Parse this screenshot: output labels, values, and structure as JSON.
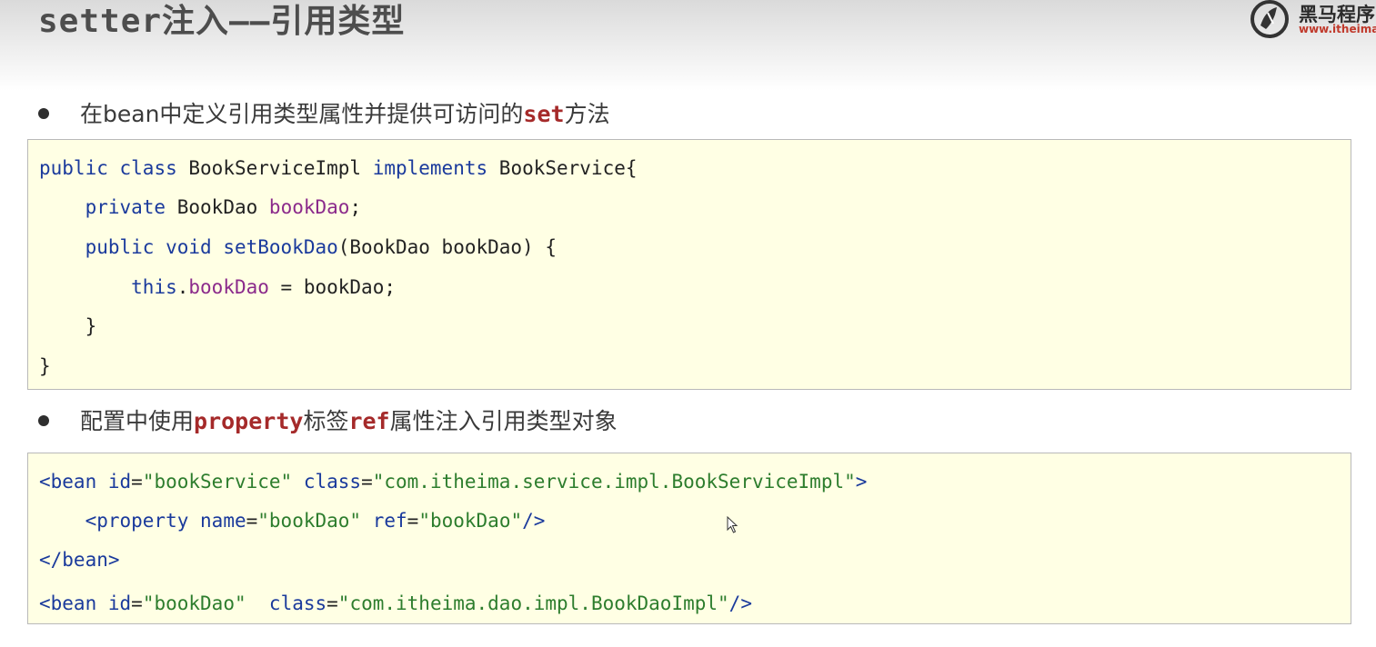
{
  "slide": {
    "title": "setter注入——引用类型",
    "logo": {
      "cn": "黑马程序",
      "url": "www.itheima.c"
    }
  },
  "bullets": [
    {
      "parts": [
        "在bean中定义引用类型属性并提供可访问的",
        "set",
        "方法"
      ]
    },
    {
      "parts": [
        "配置中使用",
        "property",
        "标签",
        "ref",
        "属性注入引用类型对象"
      ]
    }
  ],
  "java_code": {
    "line1": {
      "kw1": "public",
      "kw2": "class",
      "name": "BookServiceImpl",
      "kw3": "implements",
      "iface": "BookService{"
    },
    "line2": {
      "kw": "private",
      "type": "BookDao",
      "field": "bookDao",
      "end": ";"
    },
    "line3": {
      "kw1": "public",
      "kw2": "void",
      "method": "setBookDao",
      "params": "(BookDao bookDao) {"
    },
    "line4": {
      "kw": "this",
      "dot": ".",
      "field": "bookDao",
      "rest": " = bookDao;"
    },
    "line5": "}",
    "line6": "}"
  },
  "xml_code": {
    "line1": {
      "open": "<bean",
      "a1": "id",
      "v1": "\"bookService\"",
      "a2": "class",
      "v2": "\"com.itheima.service.impl.BookServiceImpl\"",
      "close": ">"
    },
    "line2": {
      "open": "<property",
      "a1": "name",
      "v1": "\"bookDao\"",
      "a2": "ref",
      "v2": "\"bookDao\"",
      "close": "/>"
    },
    "line3": {
      "tag": "</bean>"
    },
    "line4": {
      "open": "<bean",
      "a1": "id",
      "v1": "\"bookDao\"",
      "a2": "class",
      "v2": "\"com.itheima.dao.impl.BookDaoImpl\"",
      "close": "/>"
    }
  }
}
